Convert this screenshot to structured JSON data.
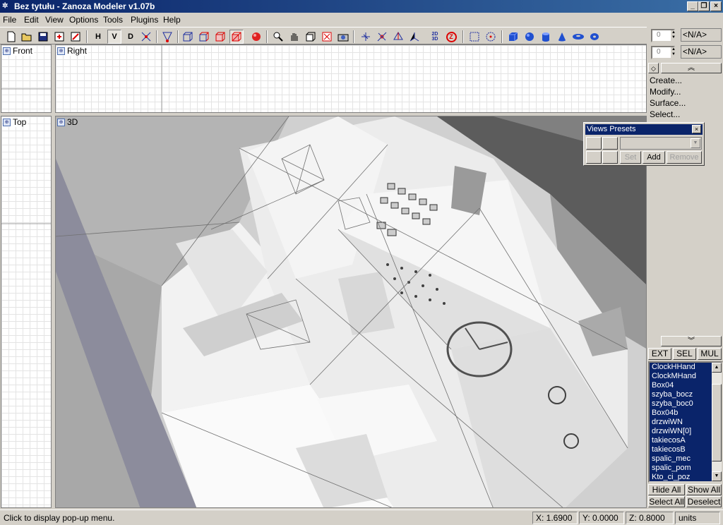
{
  "window": {
    "title": "Bez tytułu - Zanoza Modeler v1.07b"
  },
  "menu": [
    "File",
    "Edit",
    "View",
    "Options",
    "Tools",
    "Plugins",
    "Help"
  ],
  "toolbar": {
    "h_label": "H",
    "v_label": "V",
    "d_label": "D",
    "mode_label": "2D 3D",
    "z_label": "Z"
  },
  "viewports": {
    "front": "Front",
    "right": "Right",
    "top": "Top",
    "view3d": "3D"
  },
  "right_panel": {
    "spin1_value": "0",
    "spin1_na": "<N/A>",
    "spin2_value": "0",
    "spin2_na": "<N/A>",
    "commands": [
      "Create...",
      "Modify...",
      "Surface...",
      "Select..."
    ],
    "filter_buttons": [
      "EXT",
      "SEL",
      "MUL"
    ],
    "objects": [
      "ClockHHand",
      "ClockMHand",
      "Box04",
      "szyba_bocz",
      "szyba_boc0",
      "Box04b",
      "drzwiWN",
      "drzwiWN[0]",
      "takiecosA",
      "takiecosB",
      "spalic_mec",
      "spalic_pom",
      "Kto_ci_poz"
    ],
    "hide_all": "Hide All",
    "show_all": "Show All",
    "select_all": "Select All",
    "deselect": "Deselect"
  },
  "views_presets": {
    "title": "Views Presets",
    "set": "Set",
    "add": "Add",
    "remove": "Remove"
  },
  "status": {
    "hint": "Click to display pop-up menu.",
    "x": "X: 1.6900",
    "y": "Y: 0.0000",
    "z": "Z: 0.8000",
    "units": "units"
  }
}
